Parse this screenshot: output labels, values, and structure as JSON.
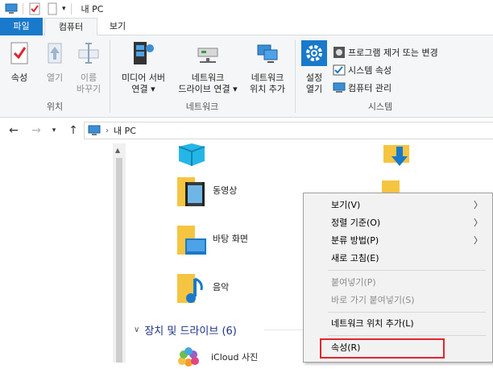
{
  "window": {
    "title": "내 PC"
  },
  "tabs": {
    "file": "파일",
    "computer": "컴퓨터",
    "view": "보기"
  },
  "ribbon": {
    "location": {
      "label": "위치",
      "properties": "속성",
      "open": "열기",
      "rename_line1": "이름",
      "rename_line2": "바꾸기"
    },
    "network": {
      "label": "네트워크",
      "media_line1": "미디어 서버",
      "media_line2": "연결",
      "map_line1": "네트워크",
      "map_line2": "드라이브 연결",
      "add_line1": "네트워크",
      "add_line2": "위치 추가"
    },
    "system": {
      "label": "시스템",
      "settings_line1": "설정",
      "settings_line2": "열기",
      "uninstall": "프로그램 제거 또는 변경",
      "sys_props": "시스템 속성",
      "manage": "컴퓨터 관리"
    }
  },
  "address": {
    "path": "내 PC"
  },
  "content": {
    "folders": [
      {
        "name": "동영상"
      },
      {
        "name": "바탕 화면"
      },
      {
        "name": "음악"
      }
    ],
    "devices_header": "장치 및 드라이브 (6)",
    "icloud_photos": "iCloud 사진"
  },
  "context_menu": {
    "view": "보기(V)",
    "sort": "정렬 기준(O)",
    "group": "분류 방법(P)",
    "refresh": "새로 고침(E)",
    "paste": "붙여넣기(P)",
    "paste_shortcut": "바로 가기 붙여넣기(S)",
    "add_network": "네트워크 위치 추가(L)",
    "properties": "속성(R)"
  },
  "colors": {
    "accent": "#1979ca",
    "highlight": "#e0262f",
    "folder": "#f5c542"
  }
}
